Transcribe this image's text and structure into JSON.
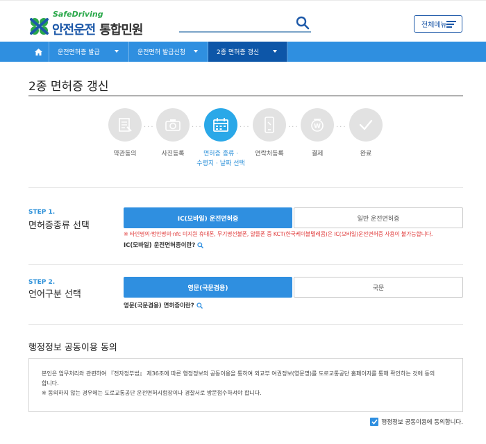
{
  "header": {
    "logo_sub": "SafeDriving",
    "logo_main_a": "안전운전",
    "logo_main_b": "통합민원",
    "search_value": "",
    "allmenu_label": "전체메뉴"
  },
  "nav": {
    "items": [
      {
        "label": "운전면허증 발급"
      },
      {
        "label": "운전면허 발급신청"
      },
      {
        "label": "2종 면허증 갱신"
      }
    ]
  },
  "page": {
    "title": "2종 면허증 갱신"
  },
  "steps": [
    {
      "label": "약관동의",
      "icon": "document-icon",
      "active": false
    },
    {
      "label": "사진등록",
      "icon": "camera-icon",
      "active": false
    },
    {
      "label": "면허증 종류 ·",
      "label2": "수령지 · 날짜 선택",
      "icon": "calendar-icon",
      "active": true
    },
    {
      "label": "연락처등록",
      "icon": "phone-icon",
      "active": false
    },
    {
      "label": "결제",
      "icon": "payment-icon",
      "active": false
    },
    {
      "label": "완료",
      "icon": "check-icon",
      "active": false
    }
  ],
  "step1": {
    "no": "STEP 1.",
    "title": "면허증종류 선택",
    "option_on": "IC(모바일) 운전면허증",
    "option_off": "일반 운전면허증",
    "warning": "※ 타인명의·법인명의·nfc 미지원 휴대폰, 무기명선불폰, 알뜰폰 중 KCT(한국케이블텔레콤)은 IC(모바일)운전면허증 사용이 불가능합니다.",
    "help": "IC(모바일) 운전면허증이란?"
  },
  "step2": {
    "no": "STEP 2.",
    "title": "언어구분 선택",
    "option_on": "영문(국문겸용)",
    "option_off": "국문",
    "help": "영문(국문겸용) 면허증이란?"
  },
  "info": {
    "title": "행정정보 공동이용 동의",
    "line1": "본인은 업무처리와 관련하여 『전자정부법』 제36조에 따른 행정정보의 공동이용을 통하여 외교부 여권정보(영문명)를 도로교통공단 홈페이지를 통해 확인하는 것에 동의",
    "line2": "합니다.",
    "line3": "※ 동의하지 않는 경우에는 도로교통공단 운전면허시험장이나 경찰서로 방문접수하셔야 합니다.",
    "agree_label": "행정정보 공동이용에 동의합니다."
  },
  "colors": {
    "primary": "#2f8fe0",
    "nav_active": "#0d56a8",
    "step_active": "#2aa8e8",
    "warning": "#e03b3b",
    "logo_green": "#2aa84a",
    "logo_blue": "#1c58a8"
  }
}
